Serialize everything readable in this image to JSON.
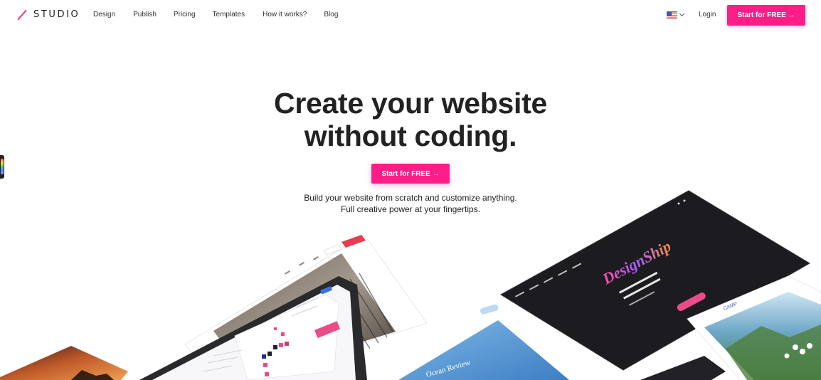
{
  "nav": {
    "logo_text": "STUDIO",
    "links": [
      "Design",
      "Publish",
      "Pricing",
      "Templates",
      "How it works?",
      "Blog"
    ],
    "language_flag": "us-flag-icon",
    "login_label": "Login",
    "cta_label": "Start for FREE →"
  },
  "hero": {
    "title_line1": "Create your website",
    "title_line2": "without coding.",
    "cta_label": "Start for FREE →",
    "subtitle_line1": "Build your website from scratch and customize anything.",
    "subtitle_line2": "Full creative power at your fingertips."
  },
  "mockups": {
    "dark_site_title": "DesignShip",
    "beach_site_label": "Ocean Review",
    "lake_site_label": "CAMP"
  },
  "colors": {
    "accent": "#ff1e87",
    "text": "#222222",
    "dark_panel": "#1c1c20"
  }
}
